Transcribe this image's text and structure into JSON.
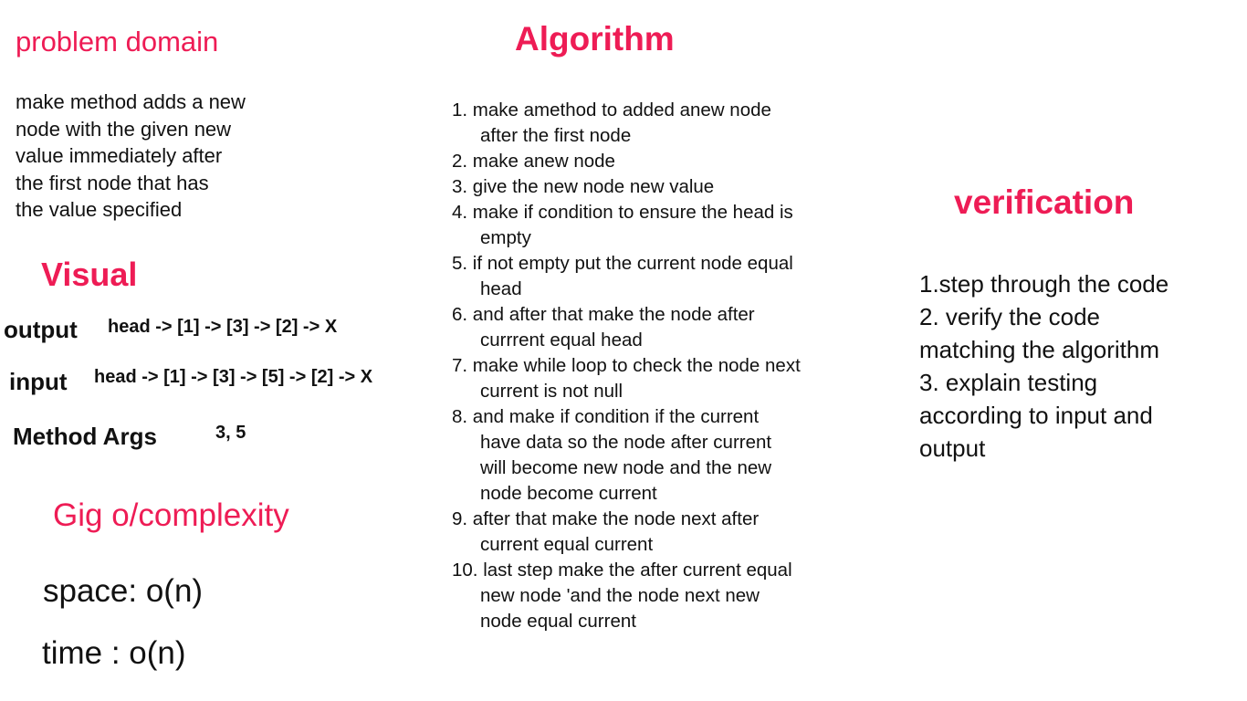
{
  "problem_domain": {
    "title": "problem domain",
    "lines": [
      "make method adds a new",
      "node with the given new",
      "value immediately after",
      "the first node that has",
      "the value specified"
    ]
  },
  "visual": {
    "title": "Visual",
    "output_label": "output",
    "output_value": "head -> [1] -> [3] -> [2] -> X",
    "input_label": "input",
    "input_value": "head -> [1] -> [3] -> [5] -> [2] -> X",
    "args_label": "Method Args",
    "args_value": "3, 5"
  },
  "big_o": {
    "title": "Gig o/complexity",
    "space": "space: o(n)",
    "time": "time :  o(n)"
  },
  "algorithm": {
    "title": "Algorithm",
    "steps": [
      [
        "1. make amethod to added anew node",
        "after the first node"
      ],
      [
        "2. make anew node"
      ],
      [
        "3. give the new node new value"
      ],
      [
        "4. make if condition to ensure the head is",
        "empty"
      ],
      [
        "5. if not empty put the current node equal",
        "head"
      ],
      [
        "6. and after that make the node after",
        "currrent equal head"
      ],
      [
        "7. make while loop to check the node next",
        "current is not null"
      ],
      [
        "8. and make if condition if the current",
        "have data so the node after current",
        "will become new node and the new",
        "node become current"
      ],
      [
        "9. after that make  the node next after",
        "current equal current"
      ],
      [
        "10. last step make the after current equal",
        "new node 'and the node next new",
        "node equal current"
      ]
    ]
  },
  "verification": {
    "title": "verification",
    "lines": [
      "1.step through the code",
      "2. verify the code",
      "matching the algorithm",
      "3. explain  testing",
      "according to input and",
      "output"
    ]
  },
  "colors": {
    "accent": "#ee1c55",
    "text": "#111111",
    "background": "#ffffff"
  }
}
